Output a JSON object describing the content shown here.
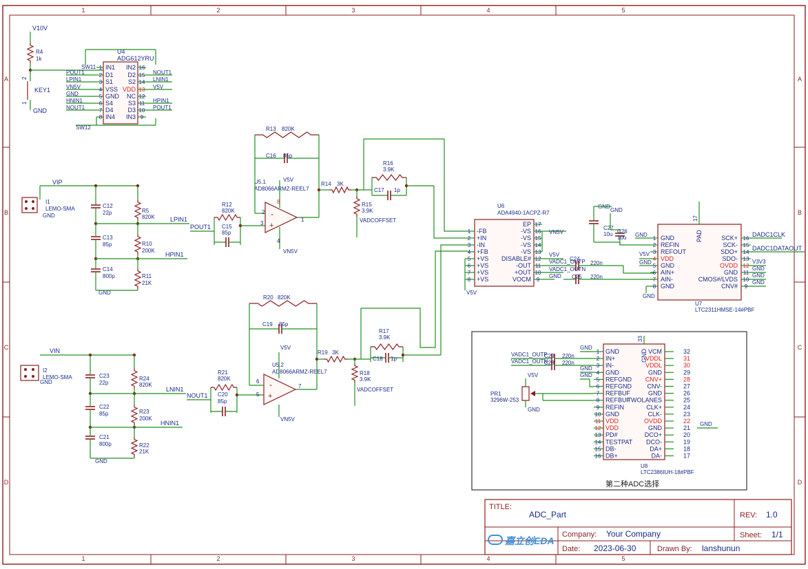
{
  "title_block": {
    "title_label": "TITLE:",
    "title": "ADC_Part",
    "rev_label": "REV:",
    "rev": "1.0",
    "company_label": "Company:",
    "company": "Your Company",
    "sheet_label": "Sheet:",
    "sheet": "1/1",
    "date_label": "Date:",
    "date": "2023-06-30",
    "drawn_label": "Drawn By:",
    "drawn": "lanshunun",
    "logo": "嘉立创EDA"
  },
  "grid_columns": [
    "1",
    "2",
    "3",
    "4",
    "5"
  ],
  "grid_rows": [
    "A",
    "B",
    "C",
    "D"
  ],
  "labels": {
    "v10v": "V10V",
    "r4": "R4",
    "r4_val": "1k",
    "key1": "KEY1",
    "gnd": "GND",
    "u4": "U4",
    "u4_part": "ADG612YRU",
    "sw11": "SW11",
    "sw12": "SW12",
    "pout1": "POUT1",
    "lpin1": "LPIN1",
    "vn5v": "VN5V",
    "hnin1": "HNIN1",
    "nout1": "NOUT1",
    "lnin1": "LNIN1",
    "v5v": "V5V",
    "hpin1": "HPIN1",
    "vip": "VIP",
    "vin": "VIN",
    "i1": "I1",
    "i2": "I2",
    "lemo": "LEMO-SMA",
    "c12": "C12",
    "c12_val": "22p",
    "c13": "C13",
    "c13_val": "85p",
    "c14": "C14",
    "c14_val": "800p",
    "r5": "R5",
    "r5_val": "820K",
    "r10": "R10",
    "r10_val": "200K",
    "r11": "R11",
    "r11_val": "21K",
    "r12": "R12",
    "r12_val": "820K",
    "c15": "C15",
    "c15_val": "85p",
    "r13": "R13",
    "r13_val": "820K",
    "c16": "C16",
    "c16_val": "85p",
    "u5_1": "U5.1",
    "u5_part": "AD8066ARMZ-REEL7",
    "r14": "R14",
    "r14_val": "3K",
    "r15": "R15",
    "r15_val": "3.9K",
    "r16": "R16",
    "r16_val": "3.9K",
    "c17": "C17",
    "c17_val": "1p",
    "vadcoffset": "VADCOFFSET",
    "c23": "C23",
    "c23_val": "22p",
    "c22": "C22",
    "c22_val": "85p",
    "c21": "C21",
    "c21_val": "800p",
    "r24": "R24",
    "r24_val": "820K",
    "r23": "R23",
    "r23_val": "200K",
    "r22": "R22",
    "r22_val": "21K",
    "r21": "R21",
    "r21_val": "820K",
    "c20": "C20",
    "c20_val": "85p",
    "r20": "R20",
    "r20_val": "820K",
    "c19": "C19",
    "c19_val": "85p",
    "u5_2": "U5.2",
    "r19": "R19",
    "r19_val": "3K",
    "r18": "R18",
    "r18_val": "3.9K",
    "r17": "R17",
    "r17_val": "3.9K",
    "c18": "C18",
    "c18_val": "1p",
    "u6": "U6",
    "u6_part": "ADA4940-1ACPZ-R7",
    "vadc1_outp": "VADC1_OUTP",
    "vadc1_outn": "VADC1_OUTN",
    "c24": "C24",
    "c24_val": "220n",
    "c25": "C25",
    "c25_val": "220n",
    "c27": "C27",
    "c27_val": "10u",
    "c26": "C26",
    "c26_val": "10u",
    "u7": "U7",
    "u7_part": "LTC2311HMSE-14#PBF",
    "dadc1clk": "DADC1CLK",
    "dadc1dataout": "DADC1DATAOUT",
    "v3v3": "V3V3",
    "pad": "PAD",
    "u8": "U8",
    "u8_part": "LTC2386IUH-18#PBF",
    "c29": "C29",
    "c28": "C28",
    "c28_val": "220n",
    "c29_val": "220n",
    "pr1": "PR1",
    "pr1_part": "3296W-253",
    "second_adc": "第二种ADC选择"
  },
  "u4_pins": {
    "left_nums": [
      "1",
      "2",
      "3",
      "4",
      "5",
      "6",
      "7",
      "8"
    ],
    "left_names": [
      "IN1",
      "D1",
      "S1",
      "VSS",
      "GND",
      "S4",
      "D4",
      "IN4"
    ],
    "right_nums": [
      "16",
      "15",
      "14",
      "13",
      "12",
      "11",
      "10",
      "9"
    ],
    "right_names": [
      "IN2",
      "D2",
      "S2",
      "VDD",
      "NC",
      "S3",
      "D3",
      "IN3"
    ]
  },
  "u6_pins": {
    "left_nums": [
      "1",
      "2",
      "3",
      "4",
      "5",
      "6",
      "7",
      "8"
    ],
    "left_names": [
      "-FB",
      "+IN",
      "-IN",
      "+FB",
      "+VS",
      "+VS",
      "+VS",
      "+VS"
    ],
    "right_nums": [
      "17",
      "16",
      "15",
      "14",
      "13",
      "12",
      "11",
      "10",
      "9"
    ],
    "right_names": [
      "EP",
      "-VS",
      "-VS",
      "-VS",
      "-VS",
      "DISABLE#",
      "-OUT",
      "+OUT",
      "VOCM"
    ]
  },
  "u7_pins": {
    "left_nums": [
      "1",
      "2",
      "3",
      "4",
      "5",
      "6",
      "7",
      "8"
    ],
    "left_names": [
      "GND",
      "REFIN",
      "REFOUT",
      "VDD",
      "GND",
      "AIN+",
      "AIN-",
      "GND"
    ],
    "right_nums": [
      "16",
      "15",
      "14",
      "13",
      "12",
      "11",
      "10",
      "9"
    ],
    "right_names": [
      "SCK+",
      "SCK-",
      "SDO+",
      "SDO-",
      "OVDD",
      "GND",
      "CMOS#/LVDS",
      "CNV#"
    ],
    "top_num": "17"
  },
  "u8_pins": {
    "left_nums": [
      "1",
      "2",
      "3",
      "4",
      "5",
      "6",
      "7",
      "8",
      "9",
      "10",
      "11",
      "12",
      "13",
      "14",
      "15",
      "16"
    ],
    "left_names": [
      "GND",
      "IN+",
      "IN-",
      "GND",
      "REFGND",
      "REFGND",
      "REFBUF",
      "REFBUF",
      "REFIN",
      "GND",
      "VDD",
      "VDD",
      "PD#",
      "TESTPAT",
      "DB-",
      "DB+"
    ],
    "right_nums": [
      "32",
      "31",
      "30",
      "29",
      "28",
      "27",
      "26",
      "25",
      "24",
      "23",
      "22",
      "21",
      "20",
      "19",
      "18",
      "17"
    ],
    "right_names": [
      "VCM",
      "VDDL",
      "VDDL",
      "GND",
      "CNV+",
      "CNV-",
      "GND",
      "TWOLANES",
      "CLK+",
      "CLK-",
      "OVDD",
      "GND",
      "DCO+",
      "DCO-",
      "DA+",
      "DA-"
    ],
    "top_name": "GND",
    "top_num": "33"
  },
  "colors": {
    "border": "#8b1d1d",
    "wire": "#1f8f1f",
    "component": "#8b1d1d",
    "text": "#1a2a88",
    "pin_red": "#d92020",
    "body_fill": "#fff8f6"
  }
}
